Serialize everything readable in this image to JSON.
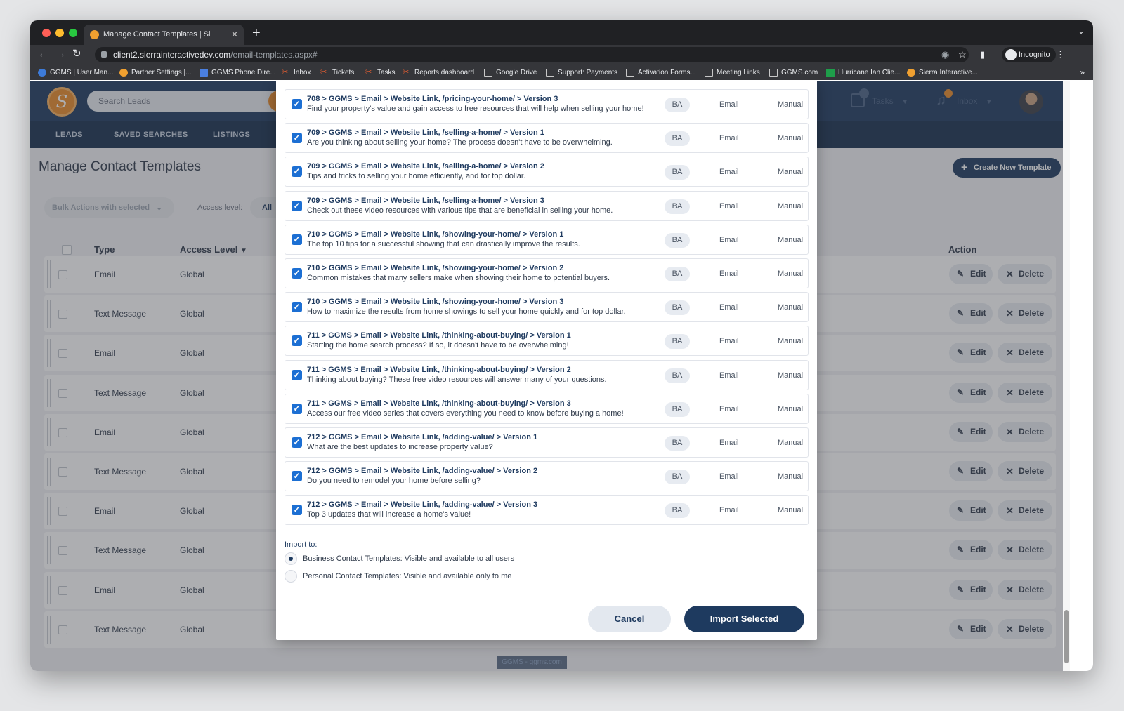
{
  "browser": {
    "tab_title": "Manage Contact Templates | Si",
    "url_host": "client2.sierrainteractivedev.com",
    "url_path": "/email-templates.aspx#",
    "incognito_label": "Incognito",
    "bookmarks": [
      "GGMS | User Man...",
      "Partner Settings |...",
      "GGMS Phone Dire...",
      "Inbox",
      "Tickets",
      "Tasks",
      "Reports dashboard",
      "Google Drive",
      "Support: Payments",
      "Activation Forms...",
      "Meeting Links",
      "GGMS.com",
      "Hurricane Ian Clie...",
      "Sierra Interactive..."
    ]
  },
  "app": {
    "search_placeholder": "Search Leads",
    "tasks_label": "Tasks",
    "tasks_count": "17",
    "inbox_label": "Inbox",
    "subnav": [
      "LEADS",
      "SAVED SEARCHES",
      "LISTINGS"
    ],
    "page_title": "Manage Contact Templates",
    "create_button": "Create New Template",
    "bulk_actions": "Bulk Actions with selected",
    "access_label": "Access level:",
    "access_value": "All",
    "columns": {
      "type": "Type",
      "access": "Access Level",
      "action": "Action"
    },
    "rows": [
      {
        "type": "Email",
        "access": "Global"
      },
      {
        "type": "Text Message",
        "access": "Global"
      },
      {
        "type": "Email",
        "access": "Global"
      },
      {
        "type": "Text Message",
        "access": "Global"
      },
      {
        "type": "Email",
        "access": "Global"
      },
      {
        "type": "Text Message",
        "access": "Global"
      },
      {
        "type": "Email",
        "access": "Global"
      },
      {
        "type": "Text Message",
        "access": "Global"
      },
      {
        "type": "Email",
        "access": "Global"
      },
      {
        "type": "Text Message",
        "access": "Global"
      }
    ],
    "edit_label": "Edit",
    "delete_label": "Delete",
    "footer_link": "GGMS - ggms.com"
  },
  "modal": {
    "items": [
      {
        "title": "708 > GGMS > Email > Website Link, /pricing-your-home/ > Version 3",
        "desc": "Find your property's value and gain access to free resources that will help when selling your home!",
        "badge": "BA",
        "type": "Email",
        "mode": "Manual"
      },
      {
        "title": "709 > GGMS > Email > Website Link, /selling-a-home/ > Version 1",
        "desc": "Are you thinking about selling your home? The process doesn't have to be overwhelming.",
        "badge": "BA",
        "type": "Email",
        "mode": "Manual"
      },
      {
        "title": "709 > GGMS > Email > Website Link, /selling-a-home/ > Version 2",
        "desc": "Tips and tricks to selling your home efficiently, and for top dollar.",
        "badge": "BA",
        "type": "Email",
        "mode": "Manual"
      },
      {
        "title": "709 > GGMS > Email > Website Link, /selling-a-home/ > Version 3",
        "desc": "Check out these video resources with various tips that are beneficial in selling your home.",
        "badge": "BA",
        "type": "Email",
        "mode": "Manual"
      },
      {
        "title": "710 > GGMS > Email > Website Link, /showing-your-home/ > Version 1",
        "desc": "The top 10 tips for a successful showing that can drastically improve the results.",
        "badge": "BA",
        "type": "Email",
        "mode": "Manual"
      },
      {
        "title": "710 > GGMS > Email > Website Link, /showing-your-home/ > Version 2",
        "desc": "Common mistakes that many sellers make when showing their home to potential buyers.",
        "badge": "BA",
        "type": "Email",
        "mode": "Manual"
      },
      {
        "title": "710 > GGMS > Email > Website Link, /showing-your-home/ > Version 3",
        "desc": "How to maximize the results from home showings to sell your home quickly and for top dollar.",
        "badge": "BA",
        "type": "Email",
        "mode": "Manual"
      },
      {
        "title": "711 > GGMS > Email > Website Link, /thinking-about-buying/ > Version 1",
        "desc": "Starting the home search process? If so, it doesn't have to be overwhelming!",
        "badge": "BA",
        "type": "Email",
        "mode": "Manual"
      },
      {
        "title": "711 > GGMS > Email > Website Link, /thinking-about-buying/ > Version 2",
        "desc": "Thinking about buying? These free video resources will answer many of your questions.",
        "badge": "BA",
        "type": "Email",
        "mode": "Manual"
      },
      {
        "title": "711 > GGMS > Email > Website Link, /thinking-about-buying/ > Version 3",
        "desc": "Access our free video series that covers everything you need to know before buying a home!",
        "badge": "BA",
        "type": "Email",
        "mode": "Manual"
      },
      {
        "title": "712 > GGMS > Email > Website Link, /adding-value/ > Version 1",
        "desc": "What are the best updates to increase property value?",
        "badge": "BA",
        "type": "Email",
        "mode": "Manual"
      },
      {
        "title": "712 > GGMS > Email > Website Link, /adding-value/ > Version 2",
        "desc": "Do you need to remodel your home before selling?",
        "badge": "BA",
        "type": "Email",
        "mode": "Manual"
      },
      {
        "title": "712 > GGMS > Email > Website Link, /adding-value/ > Version 3",
        "desc": "Top 3 updates that will increase a home's value!",
        "badge": "BA",
        "type": "Email",
        "mode": "Manual"
      }
    ],
    "import_to_label": "Import to:",
    "options": [
      {
        "label": "Business Contact Templates: Visible and available to all users",
        "selected": true
      },
      {
        "label": "Personal Contact Templates: Visible and available only to me",
        "selected": false
      }
    ],
    "cancel_label": "Cancel",
    "import_label": "Import Selected"
  }
}
